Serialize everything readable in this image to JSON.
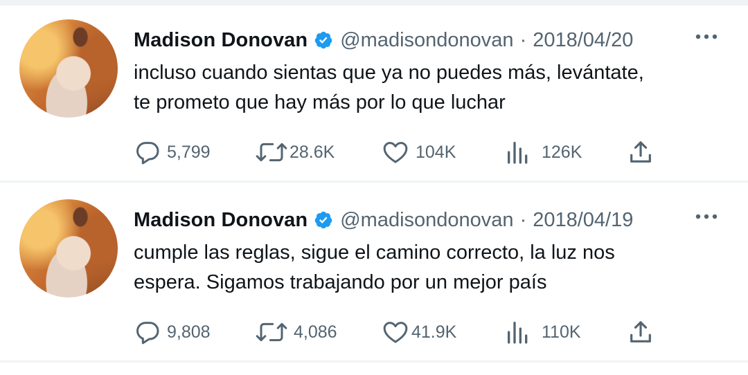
{
  "tweets": [
    {
      "author": "Madison Donovan",
      "handle": "@madisondonovan",
      "separator": "·",
      "date": "2018/04/20",
      "text_lines": [
        "incluso cuando sientas que ya no puedes más, levántate,",
        "te prometo que hay más por lo que luchar"
      ],
      "replies": "5,799",
      "retweets": "28.6K",
      "likes": "104K",
      "views": "126K"
    },
    {
      "author": "Madison Donovan",
      "handle": "@madisondonovan",
      "separator": "·",
      "date": "2018/04/19",
      "text_lines": [
        "cumple las reglas, sigue el camino correcto, la luz nos",
        "espera. Sigamos trabajando por un mejor país"
      ],
      "replies": "9,808",
      "retweets": "4,086",
      "likes": "41.9K",
      "views": "110K"
    }
  ],
  "icons": {
    "verified": "verified-badge-icon",
    "more": "more-dots-icon",
    "reply": "reply-bubble-icon",
    "retweet": "retweet-icon",
    "like": "heart-icon",
    "views": "bar-chart-icon",
    "share": "share-upload-icon"
  },
  "colors": {
    "verified_blue": "#1d9bf0",
    "muted_text": "#536471",
    "divider": "#eff3f4"
  }
}
